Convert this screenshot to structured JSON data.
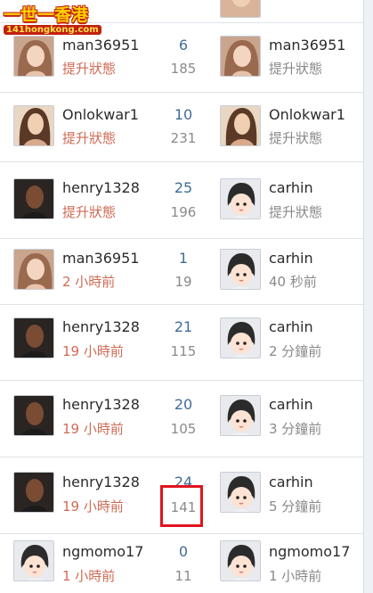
{
  "watermark": {
    "brand": "一世一香港",
    "url": "141hongkong.com"
  },
  "rows": [
    {
      "left_user": {
        "name": "man36951",
        "status": "提升狀態",
        "avatar": "woman-photo-avatar"
      },
      "count_top": "6",
      "count_bottom": "185",
      "right_user": {
        "name": "man36951",
        "status": "提升狀態",
        "avatar": "woman-photo-avatar"
      }
    },
    {
      "left_user": {
        "name": "Onlokwar1",
        "status": "提升狀態",
        "avatar": "woman-long-hair-avatar"
      },
      "count_top": "10",
      "count_bottom": "231",
      "right_user": {
        "name": "Onlokwar1",
        "status": "提升狀態",
        "avatar": "woman-long-hair-avatar"
      }
    },
    {
      "left_user": {
        "name": "henry1328",
        "status": "提升狀態",
        "avatar": "man-photo-avatar"
      },
      "count_top": "25",
      "count_bottom": "196",
      "right_user": {
        "name": "carhin",
        "status": "提升狀態",
        "avatar": "default-cartoon-avatar"
      }
    },
    {
      "left_user": {
        "name": "man36951",
        "status": "2 小時前",
        "avatar": "woman-photo-avatar"
      },
      "count_top": "1",
      "count_bottom": "19",
      "right_user": {
        "name": "carhin",
        "status": "40 秒前",
        "avatar": "default-cartoon-avatar"
      }
    },
    {
      "left_user": {
        "name": "henry1328",
        "status": "19 小時前",
        "avatar": "man-photo-avatar"
      },
      "count_top": "21",
      "count_bottom": "115",
      "right_user": {
        "name": "carhin",
        "status": "2 分鐘前",
        "avatar": "default-cartoon-avatar"
      }
    },
    {
      "left_user": {
        "name": "henry1328",
        "status": "19 小時前",
        "avatar": "man-photo-avatar"
      },
      "count_top": "20",
      "count_bottom": "105",
      "right_user": {
        "name": "carhin",
        "status": "3 分鐘前",
        "avatar": "default-cartoon-avatar"
      }
    },
    {
      "left_user": {
        "name": "henry1328",
        "status": "19 小時前",
        "avatar": "man-photo-avatar"
      },
      "count_top": "24",
      "count_bottom": "141",
      "right_user": {
        "name": "carhin",
        "status": "5 分鐘前",
        "avatar": "default-cartoon-avatar"
      }
    },
    {
      "left_user": {
        "name": "ngmomo17",
        "status": "1 小時前",
        "avatar": "default-cartoon-avatar"
      },
      "count_top": "0",
      "count_bottom": "11",
      "right_user": {
        "name": "ngmomo17",
        "status": "1 小時前",
        "avatar": "default-cartoon-avatar"
      }
    }
  ],
  "highlight": {
    "color": "#e0141e",
    "target": "rows.6.count_bottom"
  },
  "colors": {
    "count_accent": "#3f6c9a",
    "recent_status": "#cf6b55",
    "muted": "#8a8a8a",
    "divider": "#dfe3e8"
  }
}
